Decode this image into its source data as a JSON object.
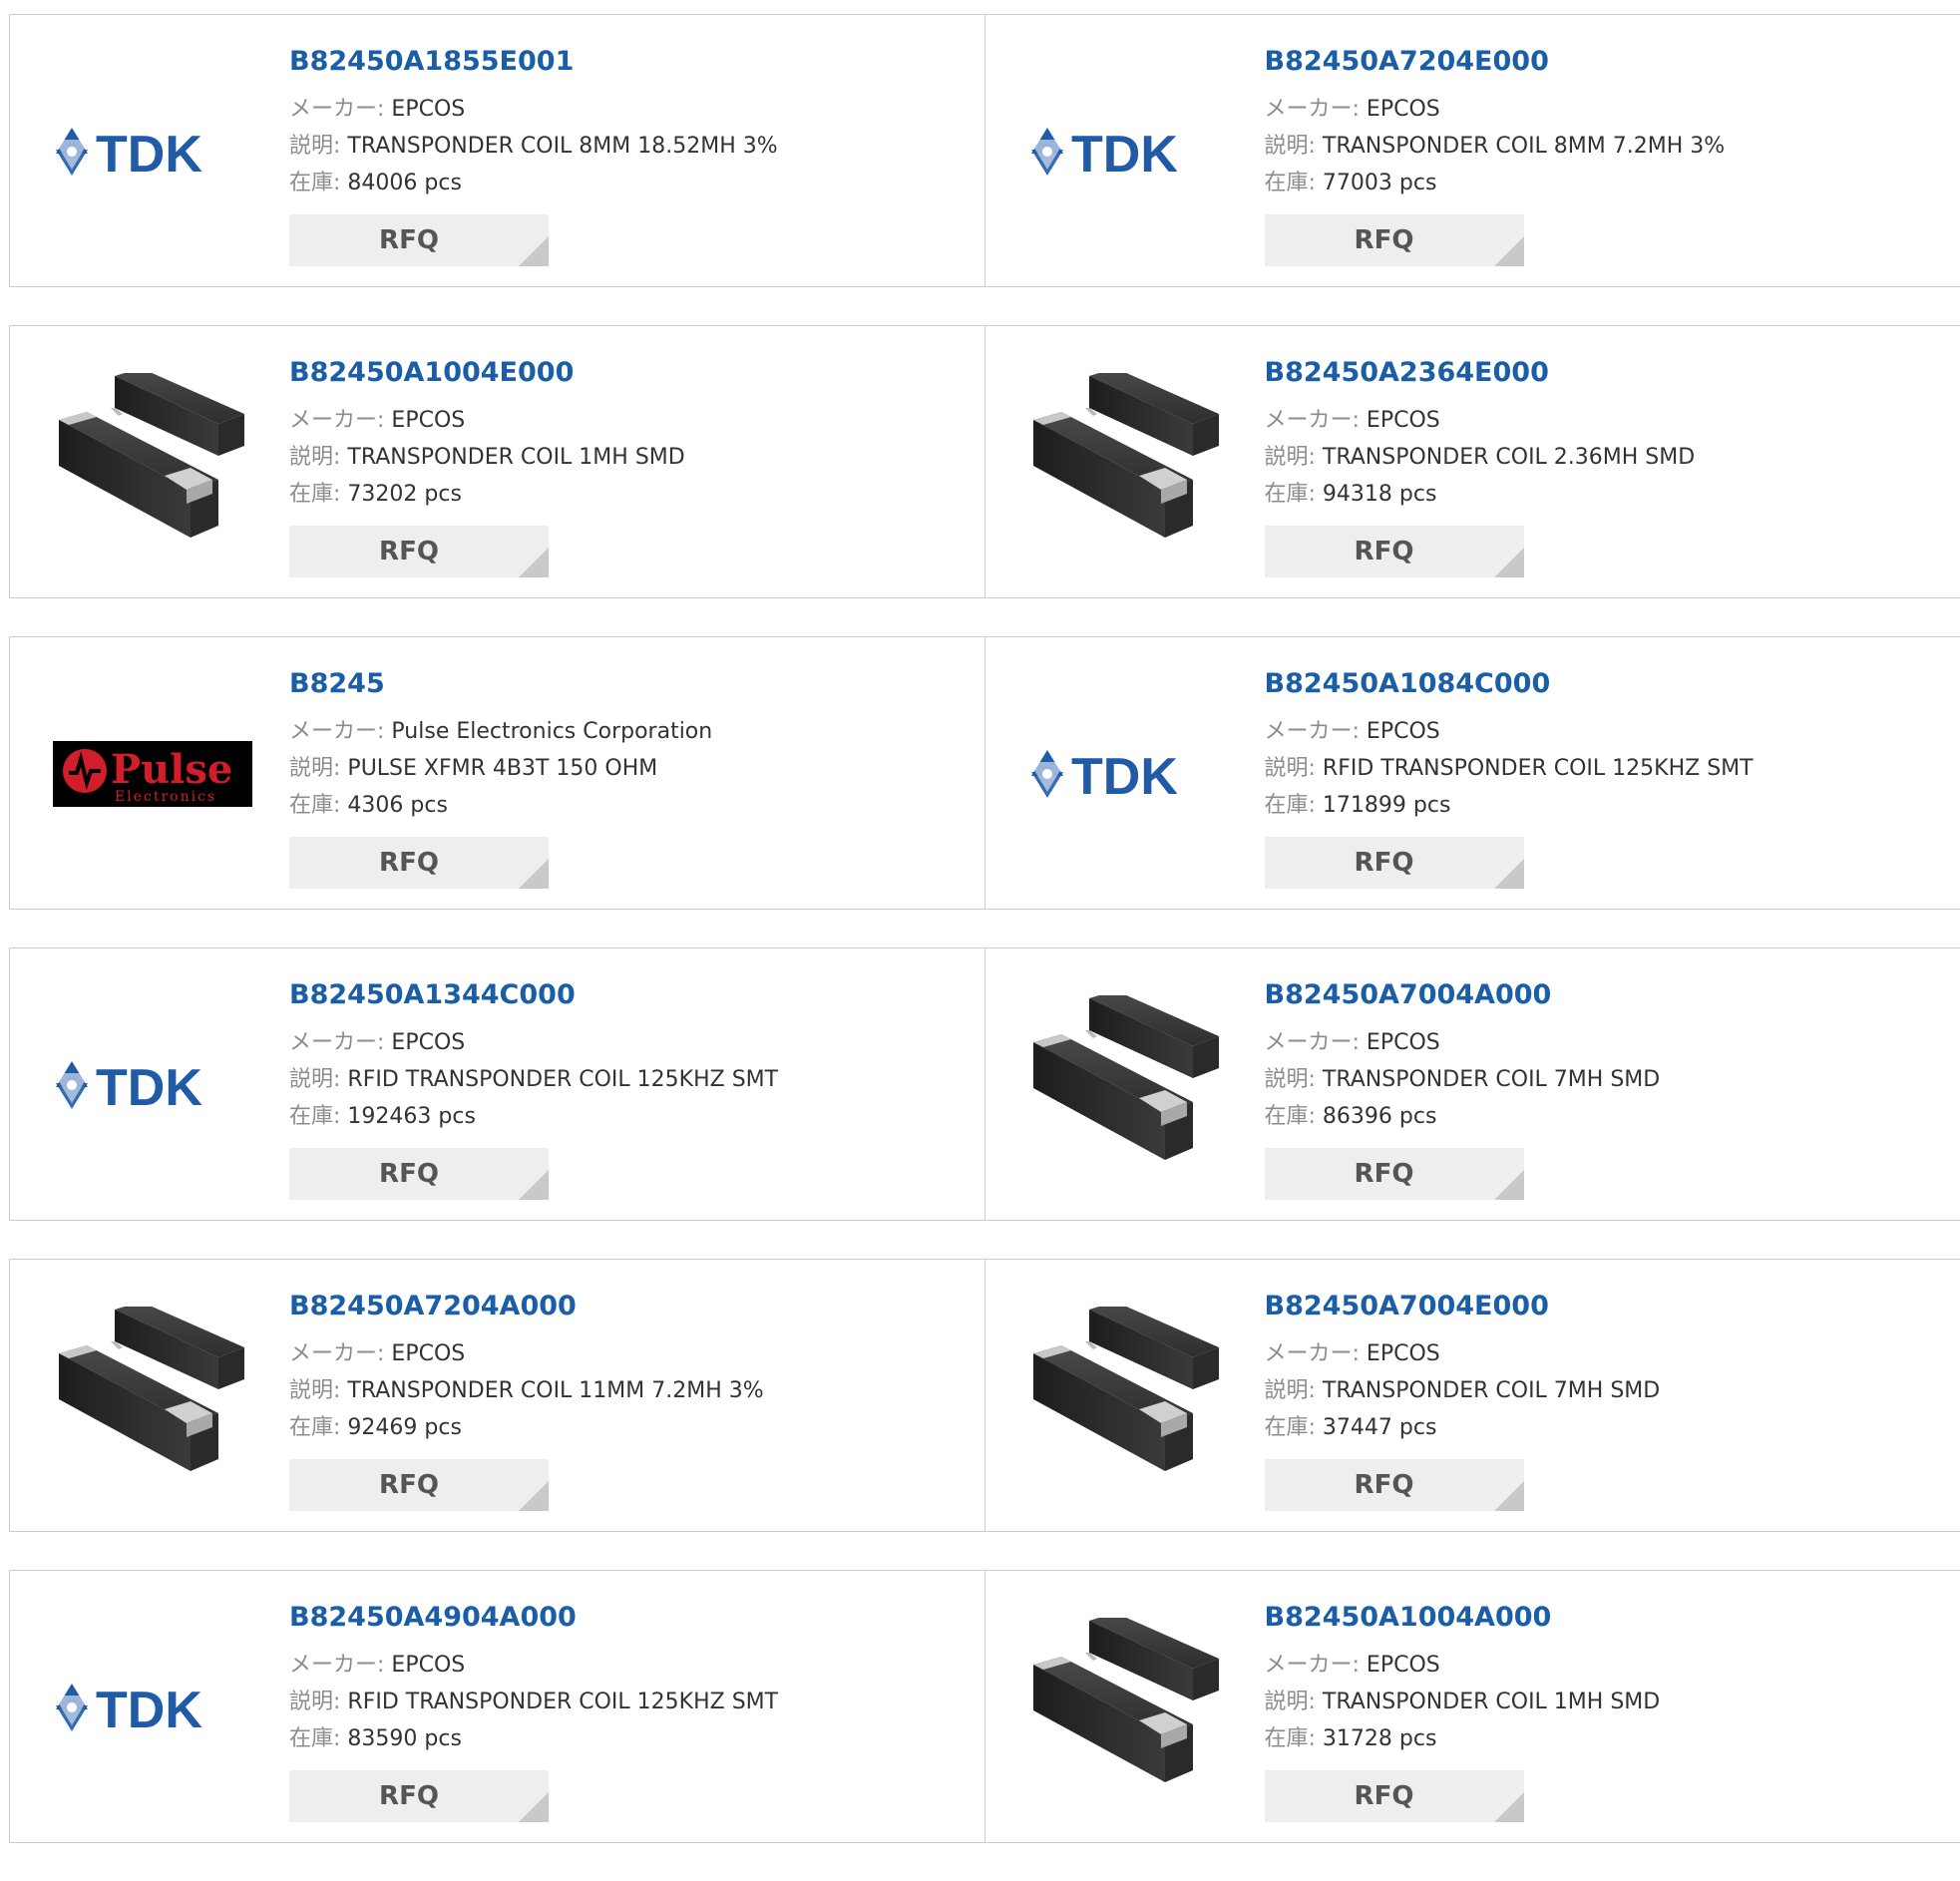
{
  "labels": {
    "maker": "メーカー:",
    "description": "説明:",
    "stock": "在庫:",
    "rfq": "RFQ"
  },
  "logos": {
    "tdk": "TDK",
    "pulse": "Pulse",
    "pulse_sub": "Electronics"
  },
  "colors": {
    "link": "#1a5ea8",
    "tdk_blue": "#1f5ba6",
    "pulse_red": "#d21e2b"
  },
  "products": [
    {
      "part": "B82450A1855E001",
      "maker": "EPCOS",
      "desc": "TRANSPONDER COIL 8MM 18.52MH 3%",
      "stock": "84006 pcs",
      "image": "tdk-logo"
    },
    {
      "part": "B82450A7204E000",
      "maker": "EPCOS",
      "desc": "TRANSPONDER COIL 8MM 7.2MH 3%",
      "stock": "77003 pcs",
      "image": "tdk-logo"
    },
    {
      "part": "B82450A1004E000",
      "maker": "EPCOS",
      "desc": "TRANSPONDER COIL 1MH SMD",
      "stock": "73202 pcs",
      "image": "coil-photo"
    },
    {
      "part": "B82450A2364E000",
      "maker": "EPCOS",
      "desc": "TRANSPONDER COIL 2.36MH SMD",
      "stock": "94318 pcs",
      "image": "coil-photo"
    },
    {
      "part": "B8245",
      "maker": "Pulse Electronics Corporation",
      "desc": "PULSE XFMR 4B3T 150 OHM",
      "stock": "4306 pcs",
      "image": "pulse-logo"
    },
    {
      "part": "B82450A1084C000",
      "maker": "EPCOS",
      "desc": "RFID TRANSPONDER COIL 125KHZ SMT",
      "stock": "171899 pcs",
      "image": "tdk-logo"
    },
    {
      "part": "B82450A1344C000",
      "maker": "EPCOS",
      "desc": "RFID TRANSPONDER COIL 125KHZ SMT",
      "stock": "192463 pcs",
      "image": "tdk-logo"
    },
    {
      "part": "B82450A7004A000",
      "maker": "EPCOS",
      "desc": "TRANSPONDER COIL 7MH SMD",
      "stock": "86396 pcs",
      "image": "coil-photo"
    },
    {
      "part": "B82450A7204A000",
      "maker": "EPCOS",
      "desc": "TRANSPONDER COIL 11MM 7.2MH 3%",
      "stock": "92469 pcs",
      "image": "coil-photo"
    },
    {
      "part": "B82450A7004E000",
      "maker": "EPCOS",
      "desc": "TRANSPONDER COIL 7MH SMD",
      "stock": "37447 pcs",
      "image": "coil-photo"
    },
    {
      "part": "B82450A4904A000",
      "maker": "EPCOS",
      "desc": "RFID TRANSPONDER COIL 125KHZ SMT",
      "stock": "83590 pcs",
      "image": "tdk-logo"
    },
    {
      "part": "B82450A1004A000",
      "maker": "EPCOS",
      "desc": "TRANSPONDER COIL 1MH SMD",
      "stock": "31728 pcs",
      "image": "coil-photo"
    }
  ]
}
